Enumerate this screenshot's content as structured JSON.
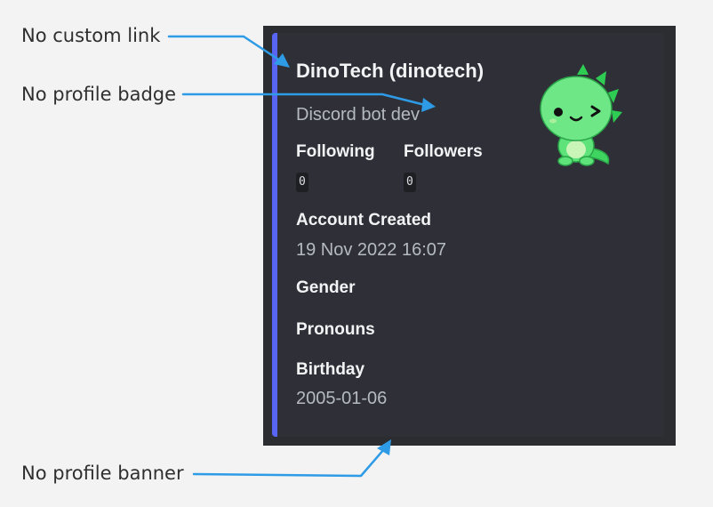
{
  "annotations": {
    "custom_link": "No custom link",
    "profile_badge": "No profile badge",
    "profile_banner": "No profile banner"
  },
  "embed": {
    "accent_color": "#5865f2",
    "author": "DinoTech (dinotech)",
    "description": "Discord bot dev",
    "thumbnail_icon": "dino-mascot-icon",
    "fields": {
      "following": {
        "name": "Following",
        "value": "0"
      },
      "followers": {
        "name": "Followers",
        "value": "0"
      },
      "account_created": {
        "name": "Account Created",
        "value": "19 Nov 2022 16:07"
      },
      "gender": {
        "name": "Gender"
      },
      "pronouns": {
        "name": "Pronouns"
      },
      "birthday": {
        "name": "Birthday",
        "value": "2005-01-06"
      }
    }
  }
}
